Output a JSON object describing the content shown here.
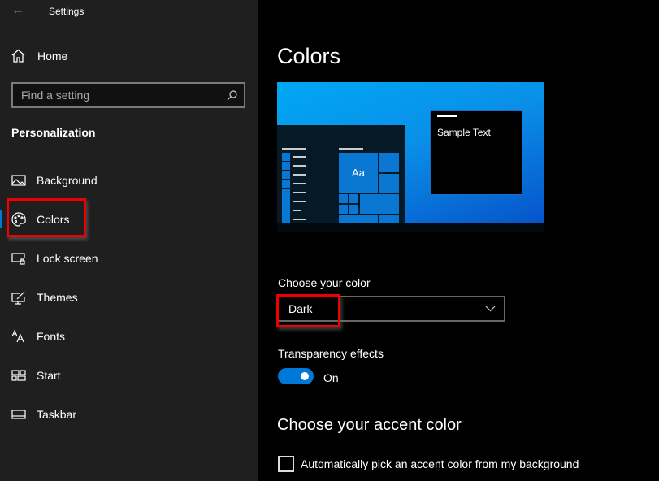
{
  "window": {
    "title": "Settings"
  },
  "sidebar": {
    "home_label": "Home",
    "search_placeholder": "Find a setting",
    "section_title": "Personalization",
    "items": [
      {
        "label": "Background",
        "icon": "image-icon"
      },
      {
        "label": "Colors",
        "icon": "palette-icon",
        "selected": true
      },
      {
        "label": "Lock screen",
        "icon": "lock-screen-icon"
      },
      {
        "label": "Themes",
        "icon": "themes-icon"
      },
      {
        "label": "Fonts",
        "icon": "fonts-icon"
      },
      {
        "label": "Start",
        "icon": "start-icon"
      },
      {
        "label": "Taskbar",
        "icon": "taskbar-icon"
      }
    ]
  },
  "main": {
    "title": "Colors",
    "preview": {
      "tile_text": "Aa",
      "sample_text": "Sample Text"
    },
    "choose_color": {
      "label": "Choose your color",
      "value": "Dark"
    },
    "transparency": {
      "label": "Transparency effects",
      "state": "On",
      "enabled": true
    },
    "accent": {
      "title": "Choose your accent color",
      "auto_pick_label": "Automatically pick an accent color from my background",
      "checked": false
    }
  },
  "colors": {
    "accent": "#0078d7",
    "highlight": "#e00000",
    "sidebar_bg": "#1f1f1f"
  }
}
